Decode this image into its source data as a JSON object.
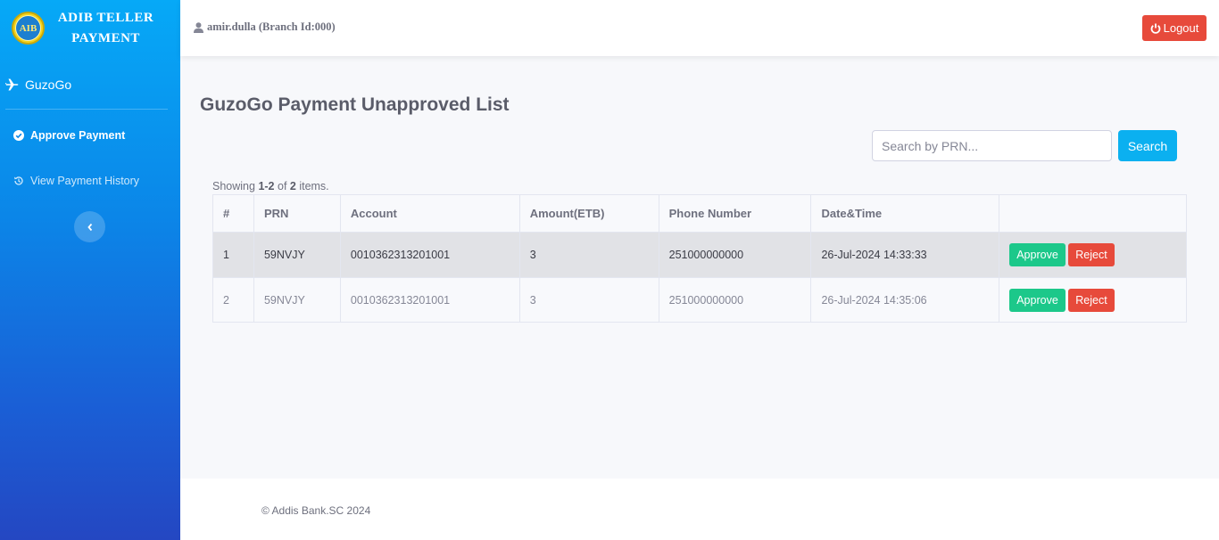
{
  "brand": {
    "logo_text": "AIB",
    "line1": "ADIB TELLER",
    "line2": "PAYMENT"
  },
  "sidebar": {
    "section": {
      "label": "GuzoGo",
      "icon": "plane-icon"
    },
    "items": [
      {
        "label": "Approve Payment",
        "icon": "check-circle-icon",
        "active": true
      },
      {
        "label": "View Payment History",
        "icon": "history-icon",
        "active": false
      }
    ],
    "toggle_icon": "chevron-left-icon"
  },
  "topbar": {
    "user": "amir.dulla (Branch Id:000)",
    "logout_label": "Logout"
  },
  "main": {
    "title": "GuzoGo Payment Unapproved List",
    "search": {
      "placeholder": "Search by PRN...",
      "value": "",
      "button_label": "Search"
    },
    "summary": {
      "prefix": "Showing ",
      "range": "1-2",
      "middle": " of ",
      "total": "2",
      "suffix": " items."
    },
    "table": {
      "columns": [
        "#",
        "PRN",
        "Account",
        "Amount(ETB)",
        "Phone Number",
        "Date&Time",
        ""
      ],
      "rows": [
        {
          "num": "1",
          "prn": "59NVJY",
          "account": "0010362313201001",
          "amount": "3",
          "phone": "251000000000",
          "datetime": "26-Jul-2024 14:33:33",
          "approve": "Approve",
          "reject": "Reject"
        },
        {
          "num": "2",
          "prn": "59NVJY",
          "account": "0010362313201001",
          "amount": "3",
          "phone": "251000000000",
          "datetime": "26-Jul-2024 14:35:06",
          "approve": "Approve",
          "reject": "Reject"
        }
      ]
    }
  },
  "footer": {
    "text": "© Addis Bank.SC 2024"
  },
  "colors": {
    "accent": "#0bb0f0",
    "approve": "#1cc88a",
    "reject": "#e74a3b",
    "sidebar_top": "#06a9f7",
    "sidebar_bottom": "#2447c2"
  }
}
